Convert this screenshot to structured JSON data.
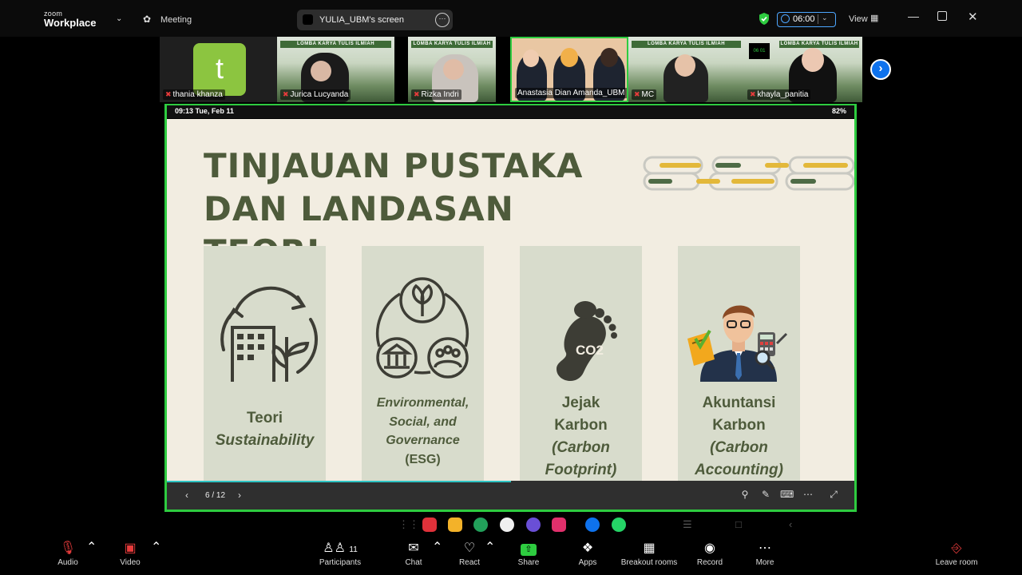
{
  "app": {
    "brand_small": "zoom",
    "brand_big": "Workplace",
    "meeting_label": "Meeting",
    "share_label": "YULIA_UBM's screen",
    "timer": "06:00",
    "view_label": "View"
  },
  "participants": [
    {
      "name": "thania khanza",
      "avatar_letter": "t"
    },
    {
      "name": "Jurica Lucyanda",
      "banner": "LOMBA KARYA TULIS ILMIAH"
    },
    {
      "name": "Rizka Indri",
      "banner": "LOMBA KARYA TULIS ILMIAH"
    },
    {
      "name": "Anastasia Dian Amanda_UBM"
    },
    {
      "name": "MC",
      "banner": "LOMBA KARYA TULIS ILMIAH"
    },
    {
      "name": "khayla_panitia",
      "banner": "LOMBA KARYA TULIS ILMIAH",
      "clock": "06 01"
    }
  ],
  "device_status": {
    "time_date": "09:13  Tue, Feb 11",
    "battery": "82%"
  },
  "slide": {
    "title_line1": "TINJAUAN PUSTAKA",
    "title_line2": "DAN LANDASAN TEORI",
    "cards": [
      {
        "line1": "Teori",
        "line2": "Sustainability"
      },
      {
        "line1": "Environmental,",
        "line2": "Social, and",
        "line3": "Governance",
        "line4": "(ESG)"
      },
      {
        "line1": "Jejak",
        "line2": "Karbon",
        "line3": "(Carbon",
        "line4": "Footprint)"
      },
      {
        "line1": "Akuntansi",
        "line2": "Karbon",
        "line3": "(Carbon",
        "line4": "Accounting)"
      }
    ],
    "co2_label": "CO2",
    "page_indicator": "6 / 12",
    "progress": 0.5
  },
  "toolbar": {
    "audio": "Audio",
    "video": "Video",
    "participants": "Participants",
    "participants_count": "11",
    "chat": "Chat",
    "react": "React",
    "share": "Share",
    "apps": "Apps",
    "breakout": "Breakout rooms",
    "record": "Record",
    "more": "More",
    "leave": "Leave room"
  },
  "colors": {
    "accent_green": "#2ecc40",
    "slide_bg": "#f2ede1",
    "slide_text": "#4e5b3b",
    "card_bg": "#d8dccc",
    "zoom_blue": "#0e72ed",
    "mute_red": "#e63b3b"
  }
}
